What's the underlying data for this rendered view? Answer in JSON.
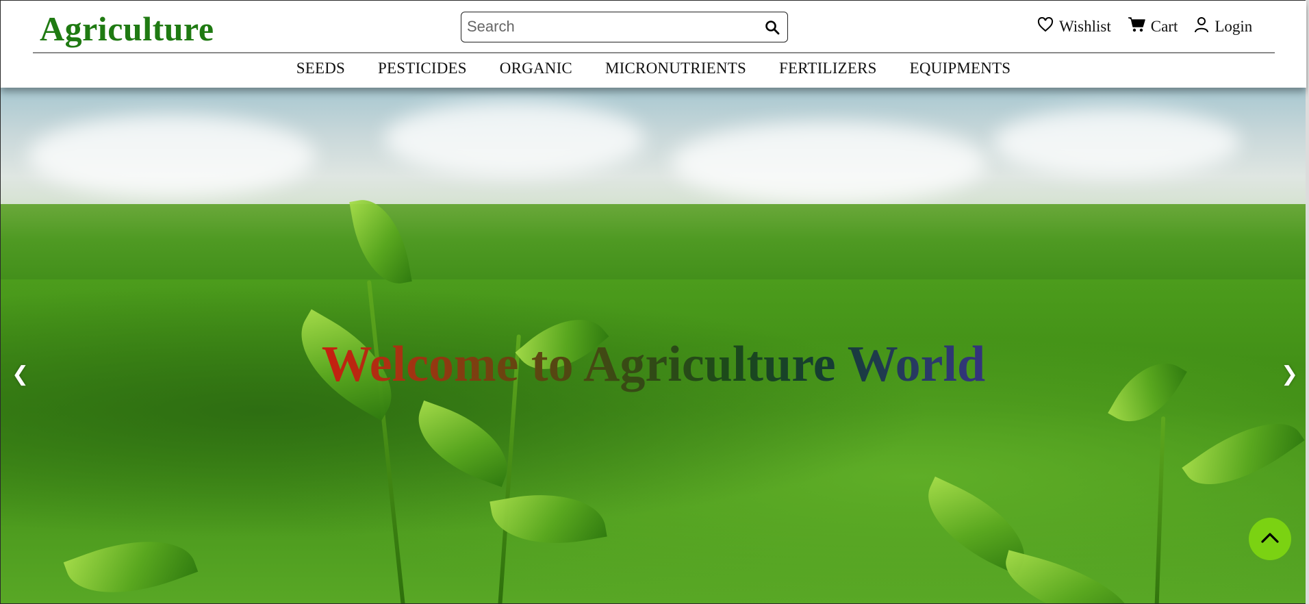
{
  "header": {
    "logo": "Agriculture",
    "search": {
      "placeholder": "Search",
      "value": ""
    },
    "actions": [
      {
        "label": "Wishlist",
        "icon": "heart-icon"
      },
      {
        "label": "Cart",
        "icon": "cart-icon"
      },
      {
        "label": "Login",
        "icon": "user-icon"
      }
    ]
  },
  "nav": {
    "items": [
      "SEEDS",
      "PESTICIDES",
      "ORGANIC",
      "MICRONUTRIENTS",
      "FERTILIZERS",
      "EQUIPMENTS"
    ]
  },
  "hero": {
    "title": "Welcome to Agriculture World",
    "prev_icon": "❮",
    "next_icon": "❯"
  },
  "colors": {
    "logo": "#1f7a12",
    "back_to_top": "#7bd212",
    "title_gradient_start": "#d4160e",
    "title_gradient_end": "#3a2f8a"
  }
}
